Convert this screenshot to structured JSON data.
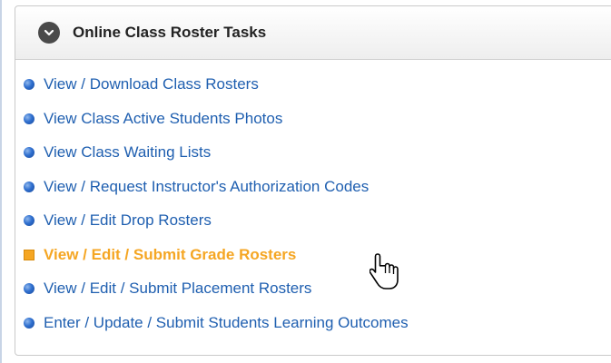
{
  "panel": {
    "title": "Online Class Roster Tasks",
    "collapse_icon": "chevron-down-circle-icon"
  },
  "tasks": [
    {
      "label": "View / Download Class Rosters",
      "bullet": "blue-circle"
    },
    {
      "label": "View Class Active Students Photos",
      "bullet": "blue-circle"
    },
    {
      "label": "View Class Waiting Lists",
      "bullet": "blue-circle"
    },
    {
      "label": "View / Request Instructor's Authorization Codes",
      "bullet": "blue-circle"
    },
    {
      "label": "View / Edit Drop Rosters",
      "bullet": "blue-circle"
    },
    {
      "label": "View / Edit / Submit Grade Rosters",
      "bullet": "orange-square",
      "hovered": true
    },
    {
      "label": "View / Edit / Submit Placement Rosters",
      "bullet": "blue-circle"
    },
    {
      "label": "Enter / Update / Submit Students Learning Outcomes",
      "bullet": "blue-circle"
    }
  ],
  "colors": {
    "link": "#1f5fb0",
    "link_hover": "#f5a623",
    "header_text": "#222222"
  },
  "cursor_icon": "hand-pointer-icon"
}
